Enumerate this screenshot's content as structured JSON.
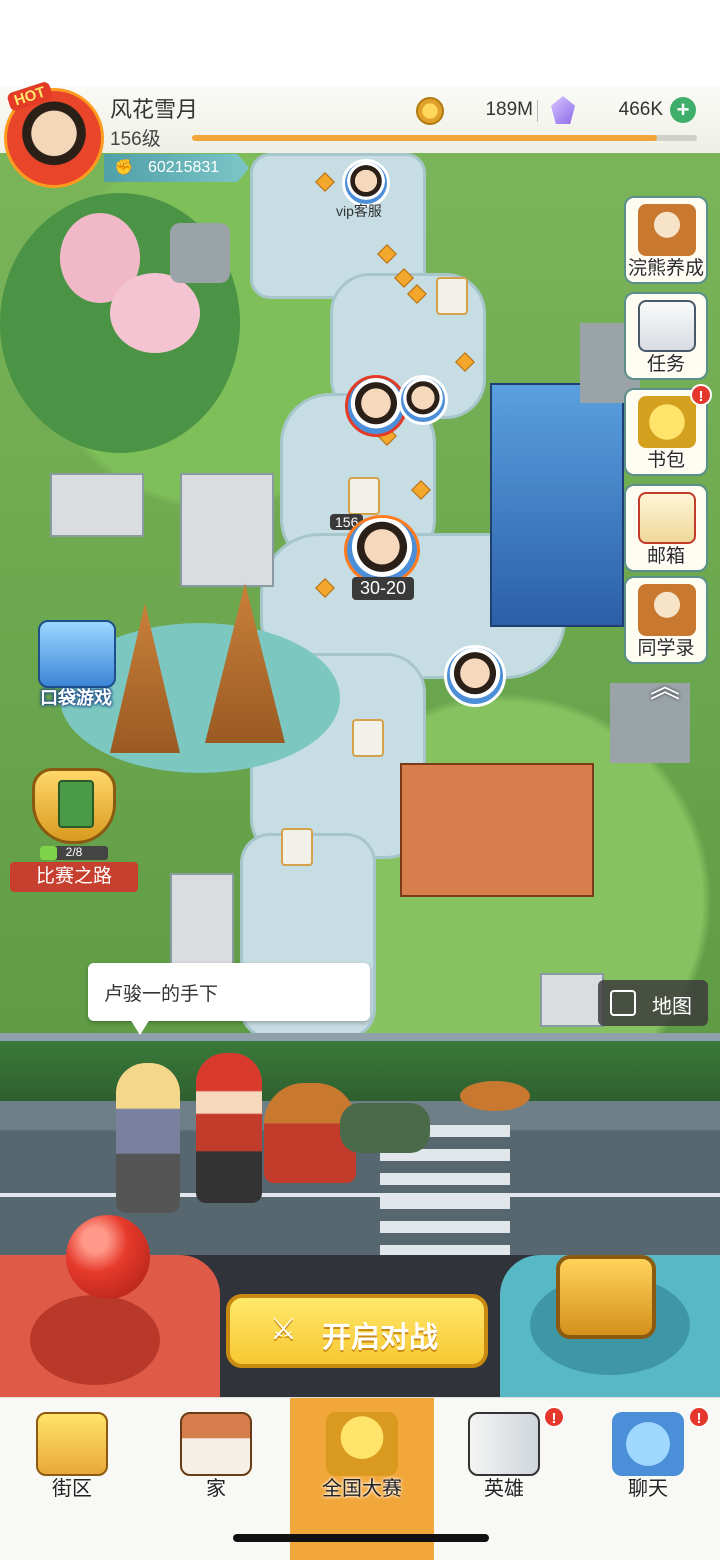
{
  "header": {
    "hot_badge": "HOT",
    "player_name": "风花雪月",
    "player_level": "156级",
    "power": "60215831",
    "coins": "189M",
    "gems": "466K",
    "xp_progress": 0.92
  },
  "map": {
    "vip_label": "vip客服",
    "level_badge": "156",
    "stage": "30-20",
    "pocket_game_label": "口袋游戏",
    "race_road_progress": "2/8",
    "race_road_label": "比赛之路",
    "map_button_label": "地图"
  },
  "side_menu": {
    "items": [
      {
        "label": "浣熊养成",
        "icon": "raccoon-icon"
      },
      {
        "label": "任务",
        "icon": "clipboard-icon"
      },
      {
        "label": "书包",
        "icon": "backpack-icon",
        "badge": "!"
      },
      {
        "label": "邮箱",
        "icon": "envelope-icon"
      },
      {
        "label": "同学录",
        "icon": "raccoon-book-icon"
      }
    ]
  },
  "dialogue": {
    "text": "卢骏一的手下"
  },
  "battle": {
    "start_label": "开启对战"
  },
  "tabbar": {
    "tabs": [
      {
        "label": "街区",
        "icon": "signpost-icon"
      },
      {
        "label": "家",
        "icon": "house-icon"
      },
      {
        "label": "全国大赛",
        "icon": "trophy-icon",
        "active": true
      },
      {
        "label": "英雄",
        "icon": "cards-icon",
        "badge": "!"
      },
      {
        "label": "聊天",
        "icon": "chat-bubble-icon",
        "badge": "!"
      }
    ]
  },
  "colors": {
    "accent": "#f2a73b",
    "xp": "#f4a53a",
    "badge_red": "#e5372b",
    "power_pill": "#4fa0a7"
  }
}
